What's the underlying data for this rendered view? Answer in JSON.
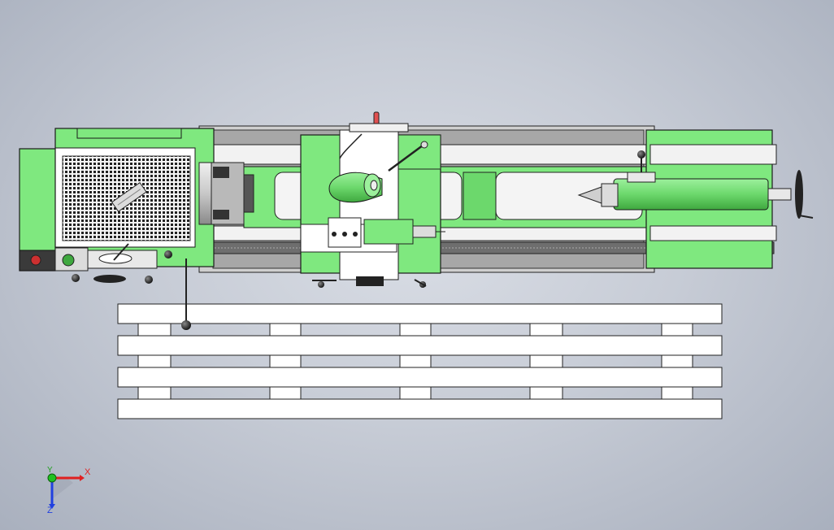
{
  "app": {
    "view": "top",
    "model": "lathe"
  },
  "colors": {
    "body_green": "#7fe87f",
    "body_green_dark": "#3fa83f",
    "outline": "#1a1a1a",
    "metal_light": "#e8e8e8",
    "metal_mid": "#b8b8b8",
    "background_top": "#d9dde5",
    "background_bottom": "#a9b0be",
    "axis_x": "#e02020",
    "axis_y": "#20a020",
    "axis_z": "#2040e0",
    "handle_red": "#e05050"
  },
  "triad": {
    "x_label": "X",
    "y_label": "Y",
    "z_label": "Z"
  }
}
